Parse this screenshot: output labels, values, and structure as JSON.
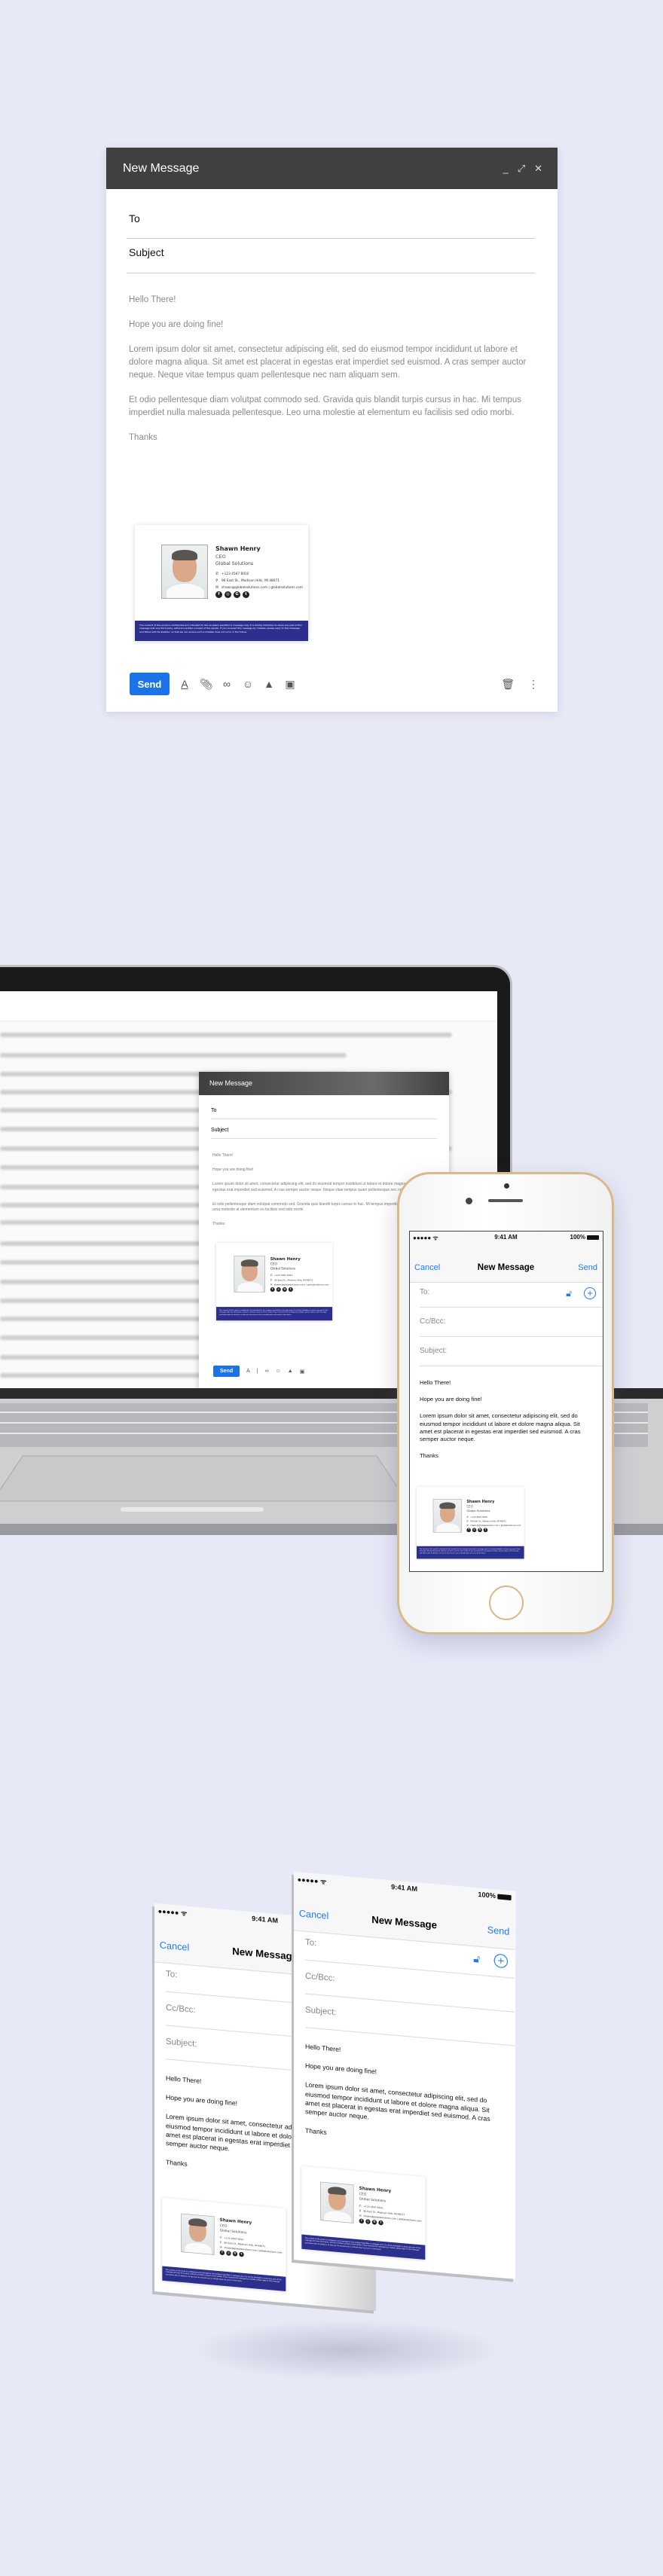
{
  "compose": {
    "title": "New Message",
    "controls": {
      "minimize": "_",
      "expand": "⤢",
      "close": "✕"
    },
    "to_label": "To",
    "subject_label": "Subject",
    "body": {
      "greeting": "Hello There!",
      "line2": "Hope you are doing fine!",
      "para1": "Lorem ipsum dolor sit amet, consectetur adipiscing elit, sed do eiusmod tempor incididunt ut labore et dolore magna aliqua. Sit amet est placerat in egestas erat imperdiet sed euismod. A cras semper auctor neque. Neque vitae tempus quam pellentesque nec nam aliquam sem.",
      "para2": " Et odio pellentesque diam volutpat commodo sed. Gravida quis blandit turpis cursus in hac. Mi tempus imperdiet nulla malesuada pellentesque. Leo urna molestie at elementum eu facilisis sed odio morbi.",
      "closing": "Thanks"
    },
    "send_label": "Send",
    "toolbar_icons": [
      "format-text-icon",
      "attach-icon",
      "link-icon",
      "emoji-icon",
      "drive-icon",
      "photo-icon",
      "trash-icon",
      "more-icon"
    ],
    "accent": "#1a73e8"
  },
  "signature": {
    "name": "Shawn Henry",
    "title": "CEO",
    "company": "Global Solutions",
    "phone": "+123 4567 8910",
    "address": "96 East St., Madison Hills, MI 48071",
    "email_web": "shawn@globalsolutions.com  |  globalsolutions.com",
    "social": [
      "facebook",
      "instagram",
      "google-plus",
      "twitter"
    ],
    "disclaimer": "The content of this email is confidential and intended for the recipient specified in message only. It is strictly forbidden to share any part of this message with any third party, without a written consent of the sender. If you received this message by mistake, please reply to this message and follow with its deletion, so that we can ensure such a mistake does not occur in the future.",
    "band_color": "#2d2f8f"
  },
  "ios": {
    "carrier": "●●●●● ᯤ",
    "time": "9:41 AM",
    "battery": "100%",
    "cancel": "Cancel",
    "title": "New Message",
    "send": "Send",
    "to": "To:",
    "ccbcc": "Cc/Bcc:",
    "subject": "Subject:",
    "greeting": "Hello There!",
    "line2": "Hope you are doing fine!",
    "para1": "Lorem ipsum dolor sit amet, consectetur adipiscing elit, sed do eiusmod tempor incididunt ut labore et dolore magna aliqua. Sit amet est placerat in egestas erat imperdiet sed euismod. A cras semper auctor neque.",
    "closing": "Thanks",
    "accent": "#1a7cf5"
  }
}
